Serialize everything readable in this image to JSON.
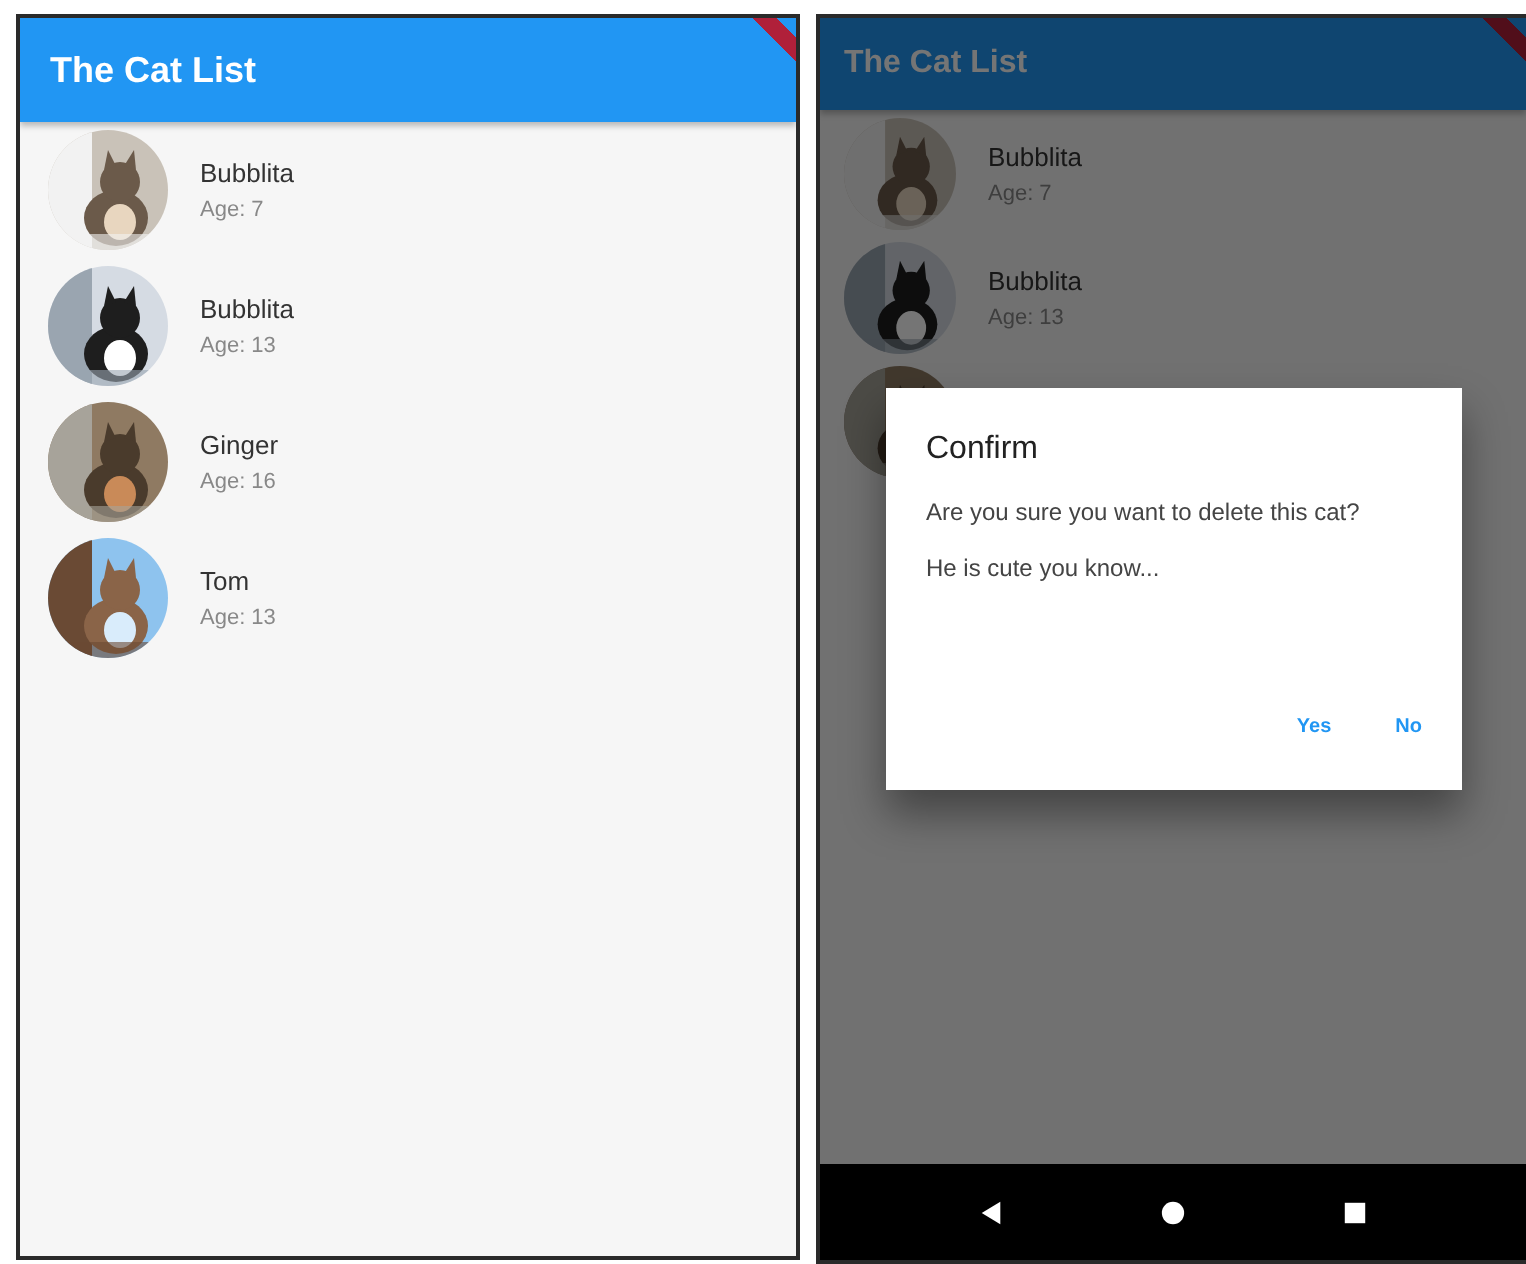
{
  "screens": [
    {
      "app_bar": {
        "title": "The Cat List"
      },
      "debug_banner": true,
      "cats": [
        {
          "kind": "cat",
          "name": "Bubblita",
          "age": "Age: 7"
        },
        {
          "kind": "cat",
          "name": "Bubblita",
          "age": "Age: 13"
        },
        {
          "kind": "cat",
          "name": "Ginger",
          "age": "Age: 16"
        },
        {
          "kind": "cat",
          "name": "Tom",
          "age": "Age: 13"
        }
      ]
    },
    {
      "app_bar": {
        "title": "The Cat List"
      },
      "debug_banner": true,
      "cats": [
        {
          "kind": "cat",
          "name": "Bubblita",
          "age": "Age: 7"
        },
        {
          "kind": "cat",
          "name": "Bubblita",
          "age": "Age: 13"
        },
        {
          "kind": "picture"
        }
      ],
      "dialog": {
        "title": "Confirm",
        "paragraphs": [
          "Are you sure you want to delete this cat?",
          "He is cute you know..."
        ],
        "actions": [
          "Yes",
          "No"
        ]
      },
      "nav_bar": true
    }
  ]
}
